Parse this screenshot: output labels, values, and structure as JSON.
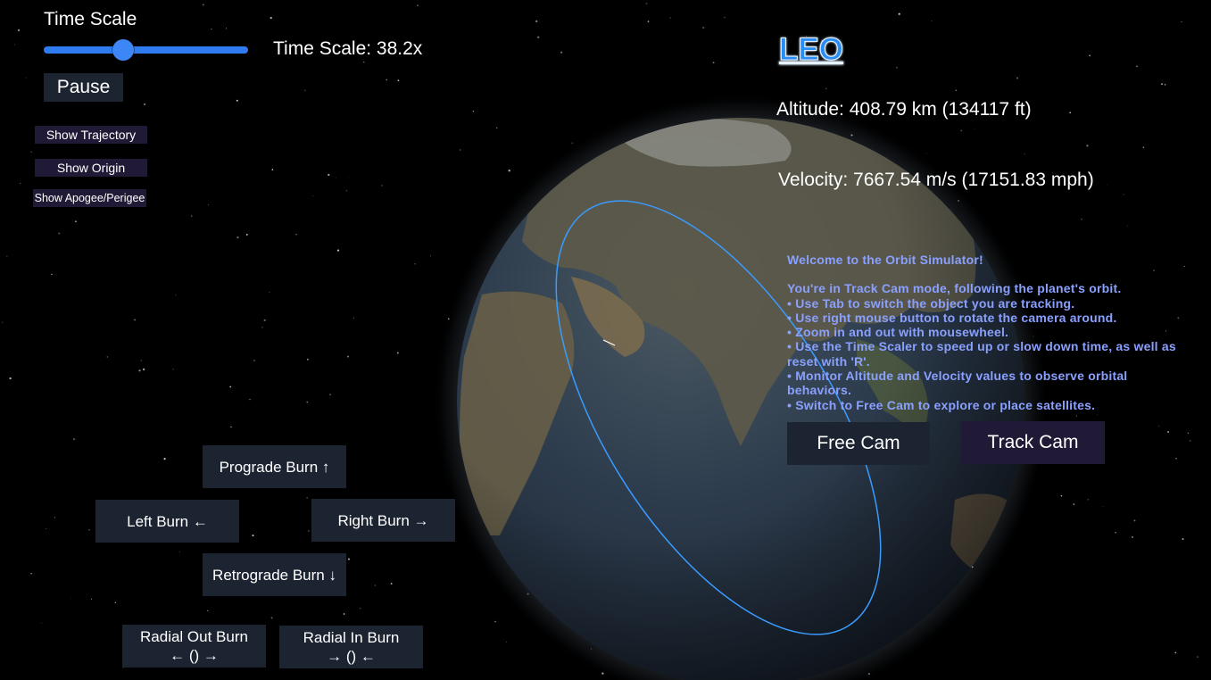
{
  "time_scale": {
    "heading": "Time Scale",
    "readout": "Time Scale: 38.2x",
    "slider_fraction": 0.39
  },
  "controls": {
    "pause_label": "Pause",
    "show_trajectory_label": "Show Trajectory",
    "show_origin_label": "Show Origin",
    "show_apogee_label": "Show Apogee/Perigee"
  },
  "burns": {
    "prograde_label": "Prograde Burn ↑",
    "left_label": "Left Burn ←",
    "right_label": "Right Burn →",
    "retrograde_label": "Retrograde Burn ↓",
    "radial_out_line1": "Radial Out Burn",
    "radial_out_line2": "← () →",
    "radial_in_line1": "Radial In Burn",
    "radial_in_line2": "→ () ←"
  },
  "orbit": {
    "name": "LEO",
    "altitude": "Altitude: 408.79 km (134117 ft)",
    "velocity": "Velocity: 7667.54 m/s (17151.83 mph)"
  },
  "welcome": {
    "title": "Welcome to the Orbit Simulator!",
    "intro": "You're in Track Cam mode, following the planet's orbit.",
    "tips": [
      "• Use Tab to switch the object you are tracking.",
      "• Use right mouse button to rotate the camera around.",
      "• Zoom in and out with mousewheel.",
      "• Use the Time Scaler to speed up or slow down time, as well as reset with 'R'.",
      "• Monitor Altitude and Velocity values to observe orbital behaviors.",
      "• Switch to Free Cam to explore or place satellites."
    ]
  },
  "camera": {
    "free_cam_label": "Free Cam",
    "track_cam_label": "Track Cam"
  },
  "colors": {
    "background": "#000000",
    "slider_accent": "#2f7bf0",
    "button_bg": "#1c2431",
    "toggle_bg": "#211a36",
    "orbit_title": "#2a8cf5",
    "welcome_text": "#8aa0ff",
    "orbit_path": "#3a9bff"
  }
}
